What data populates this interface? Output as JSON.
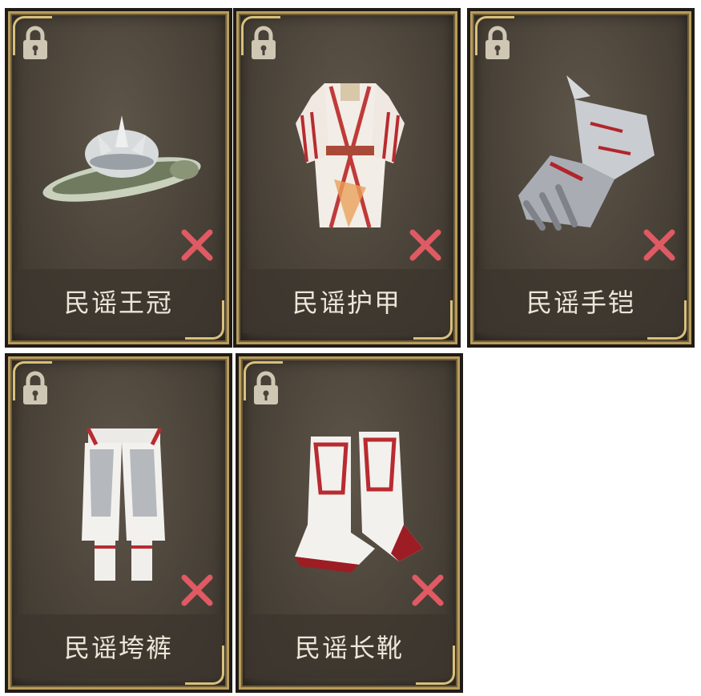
{
  "cards": [
    {
      "name": "民谣王冠",
      "icon": "hat-icon"
    },
    {
      "name": "民谣护甲",
      "icon": "armor-icon"
    },
    {
      "name": "民谣手铠",
      "icon": "gauntlet-icon"
    },
    {
      "name": "民谣垮裤",
      "icon": "pants-icon"
    },
    {
      "name": "民谣长靴",
      "icon": "boots-icon"
    }
  ],
  "colors": {
    "frame_gold": "#d9c07c",
    "card_bg": "#4a4339",
    "remove_red": "#e05a63",
    "lock_color": "#cfc6b4"
  }
}
